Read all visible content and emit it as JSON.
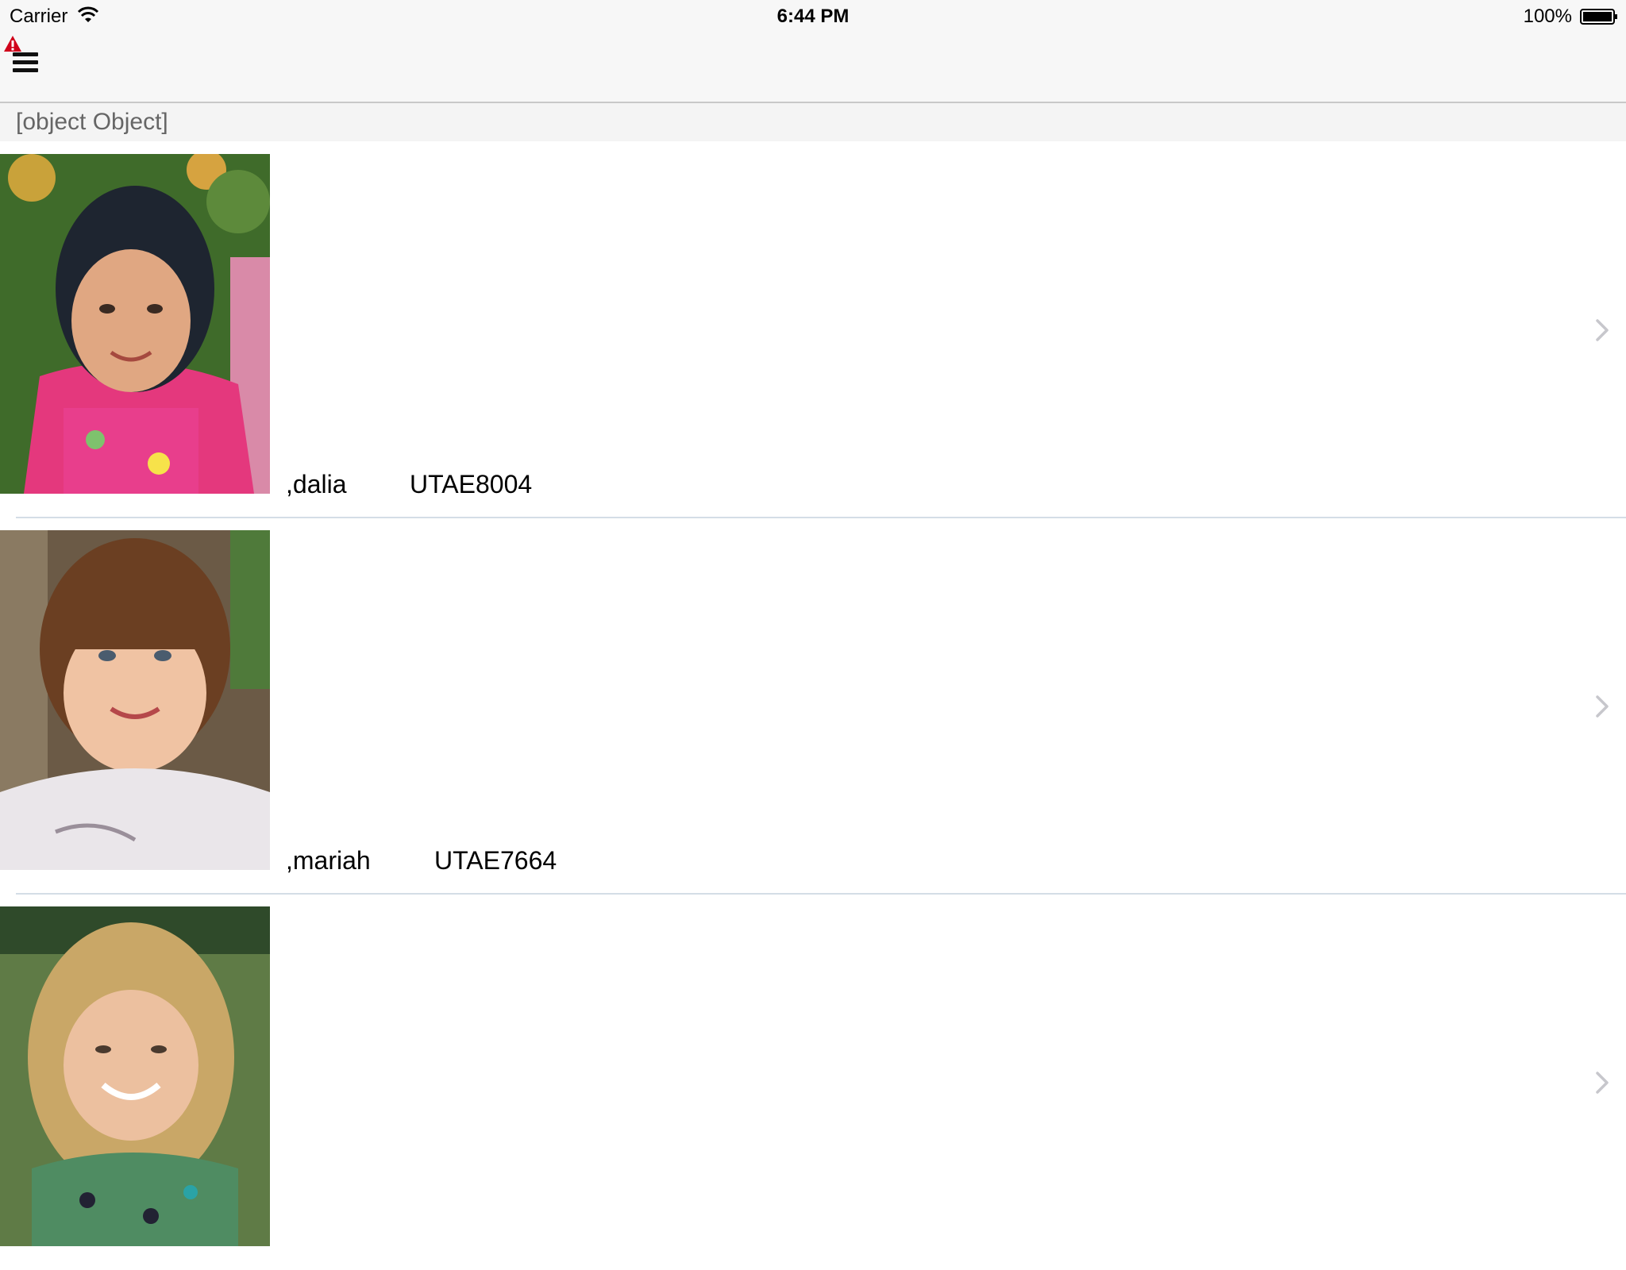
{
  "status_bar": {
    "carrier": "Carrier",
    "time": "6:44 PM",
    "battery_percent": "100%"
  },
  "nav_bar": {
    "menu_icon": "hamburger-menu-icon",
    "warning_icon": "warning-triangle-icon"
  },
  "section_header": {
    "title": "[object Object]"
  },
  "rows": [
    {
      "name": ",dalia",
      "code": "UTAE8004",
      "photo": "child-portrait-1"
    },
    {
      "name": ",mariah",
      "code": "UTAE7664",
      "photo": "child-portrait-2"
    },
    {
      "name": "",
      "code": "",
      "photo": "child-portrait-3"
    }
  ],
  "colors": {
    "bar_background": "#f7f7f7",
    "separator": "#d4dde6",
    "chevron": "#c7c7cc",
    "warning": "#d0021b"
  }
}
